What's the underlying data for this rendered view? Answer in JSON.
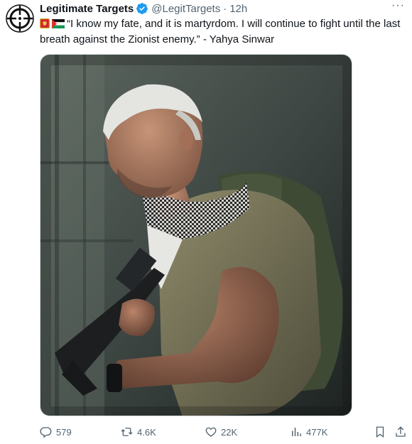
{
  "tweet": {
    "author_name": "Legitimate Targets",
    "handle": "@LegitTargets",
    "separator": "·",
    "time": "12h",
    "text": "“I know my fate, and it is martyrdom. I will continue to fight until the last breath against the Zionist enemy.” - Yahya Sinwar",
    "flags": [
      "montenegro-flag",
      "palestine-flag"
    ]
  },
  "actions": {
    "replies": "579",
    "retweets": "4.6K",
    "likes": "22K",
    "views": "477K"
  },
  "colors": {
    "text_primary": "#0f1419",
    "text_secondary": "#536471",
    "verified_blue": "#1d9bf0",
    "border": "#cfd9de"
  }
}
